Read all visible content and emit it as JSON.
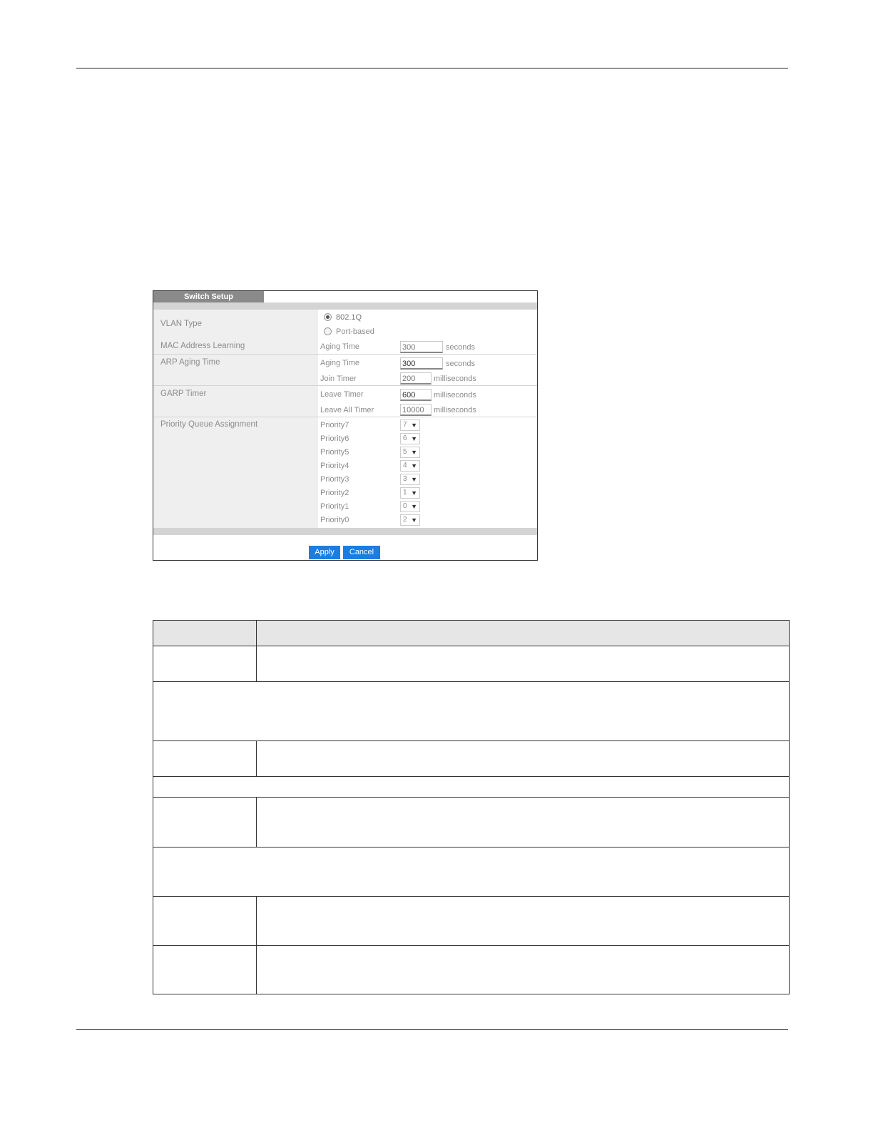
{
  "switch_setup": {
    "tab_title": "Switch Setup",
    "vlan_type": {
      "label": "VLAN Type",
      "options": [
        {
          "label": "802.1Q",
          "selected": true
        },
        {
          "label": "Port-based",
          "selected": false
        }
      ]
    },
    "mac_address_learning": {
      "label": "MAC Address Learning",
      "aging_time_label": "Aging Time",
      "aging_time_value": "300",
      "unit": "seconds"
    },
    "gvrp_aging": {
      "label": "ARP Aging Time",
      "aging_time_label": "Aging Time",
      "aging_time_value": "300",
      "aging_unit": "seconds",
      "join_timer_label": "Join Timer",
      "join_timer_value": "200",
      "join_unit": "milliseconds"
    },
    "garp_timer": {
      "label": "GARP Timer",
      "leave_timer_label": "Leave Timer",
      "leave_timer_value": "600",
      "leave_unit": "milliseconds",
      "leave_all_timer_label": "Leave All Timer",
      "leave_all_timer_value": "10000",
      "leave_all_unit": "milliseconds"
    },
    "priority_queue": {
      "label": "Priority Queue Assignment",
      "items": [
        {
          "label": "Priority7",
          "value": "7"
        },
        {
          "label": "Priority6",
          "value": "6"
        },
        {
          "label": "Priority5",
          "value": "5"
        },
        {
          "label": "Priority4",
          "value": "4"
        },
        {
          "label": "Priority3",
          "value": "3"
        },
        {
          "label": "Priority2",
          "value": "1"
        },
        {
          "label": "Priority1",
          "value": "0"
        },
        {
          "label": "Priority0",
          "value": "2"
        }
      ]
    },
    "buttons": {
      "apply": "Apply",
      "cancel": "Cancel"
    }
  }
}
